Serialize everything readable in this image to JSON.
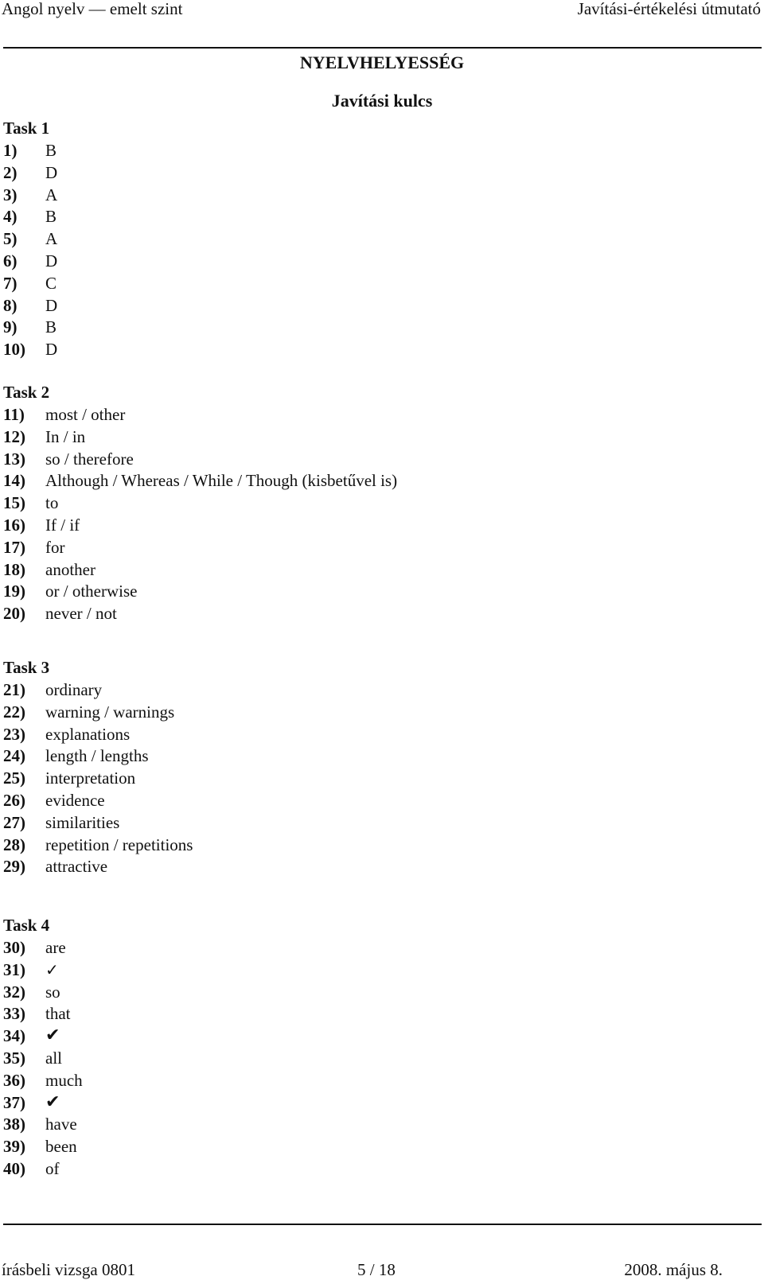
{
  "header": {
    "left": "Angol nyelv — emelt szint",
    "right": "Javítási-értékelési útmutató"
  },
  "title": "NYELVHELYESSÉG",
  "subtitle": "Javítási kulcs",
  "tasks": [
    {
      "title": "Task 1",
      "items": [
        {
          "num": "1)",
          "answer": "B"
        },
        {
          "num": "2)",
          "answer": "D"
        },
        {
          "num": "3)",
          "answer": "A"
        },
        {
          "num": "4)",
          "answer": "B"
        },
        {
          "num": "5)",
          "answer": "A"
        },
        {
          "num": "6)",
          "answer": "D"
        },
        {
          "num": "7)",
          "answer": "C"
        },
        {
          "num": "8)",
          "answer": "D"
        },
        {
          "num": "9)",
          "answer": "B"
        },
        {
          "num": "10)",
          "answer": "D"
        }
      ]
    },
    {
      "title": "Task 2",
      "items": [
        {
          "num": "11)",
          "answer": "most / other"
        },
        {
          "num": "12)",
          "answer": "In / in"
        },
        {
          "num": "13)",
          "answer": "so / therefore"
        },
        {
          "num": "14)",
          "answer": "Although / Whereas / While / Though (kisbetűvel is)"
        },
        {
          "num": "15)",
          "answer": "to"
        },
        {
          "num": "16)",
          "answer": "If / if"
        },
        {
          "num": "17)",
          "answer": "for"
        },
        {
          "num": "18)",
          "answer": "another"
        },
        {
          "num": "19)",
          "answer": "or / otherwise"
        },
        {
          "num": "20)",
          "answer": "never / not"
        }
      ]
    },
    {
      "title": "Task 3",
      "items": [
        {
          "num": "21)",
          "answer": "ordinary"
        },
        {
          "num": "22)",
          "answer": "warning / warnings"
        },
        {
          "num": "23)",
          "answer": "explanations"
        },
        {
          "num": "24)",
          "answer": "length / lengths"
        },
        {
          "num": "25)",
          "answer": "interpretation"
        },
        {
          "num": "26)",
          "answer": "evidence"
        },
        {
          "num": "27)",
          "answer": "similarities"
        },
        {
          "num": "28)",
          "answer": "repetition / repetitions"
        },
        {
          "num": "29)",
          "answer": "attractive"
        }
      ]
    },
    {
      "title": "Task 4",
      "items": [
        {
          "num": "30)",
          "answer": "are"
        },
        {
          "num": "31)",
          "answer": "✓",
          "icon": "check-icon"
        },
        {
          "num": "32)",
          "answer": "so"
        },
        {
          "num": "33)",
          "answer": "that"
        },
        {
          "num": "34)",
          "answer": "✔",
          "icon": "heavy-check-icon"
        },
        {
          "num": "35)",
          "answer": "all"
        },
        {
          "num": "36)",
          "answer": "much"
        },
        {
          "num": "37)",
          "answer": "✔",
          "icon": "heavy-check-icon"
        },
        {
          "num": "38)",
          "answer": "have"
        },
        {
          "num": "39)",
          "answer": "been"
        },
        {
          "num": "40)",
          "answer": "of"
        }
      ]
    }
  ],
  "footer": {
    "left": "írásbeli vizsga 0801",
    "center": "5 / 18",
    "right": "2008. május 8."
  }
}
